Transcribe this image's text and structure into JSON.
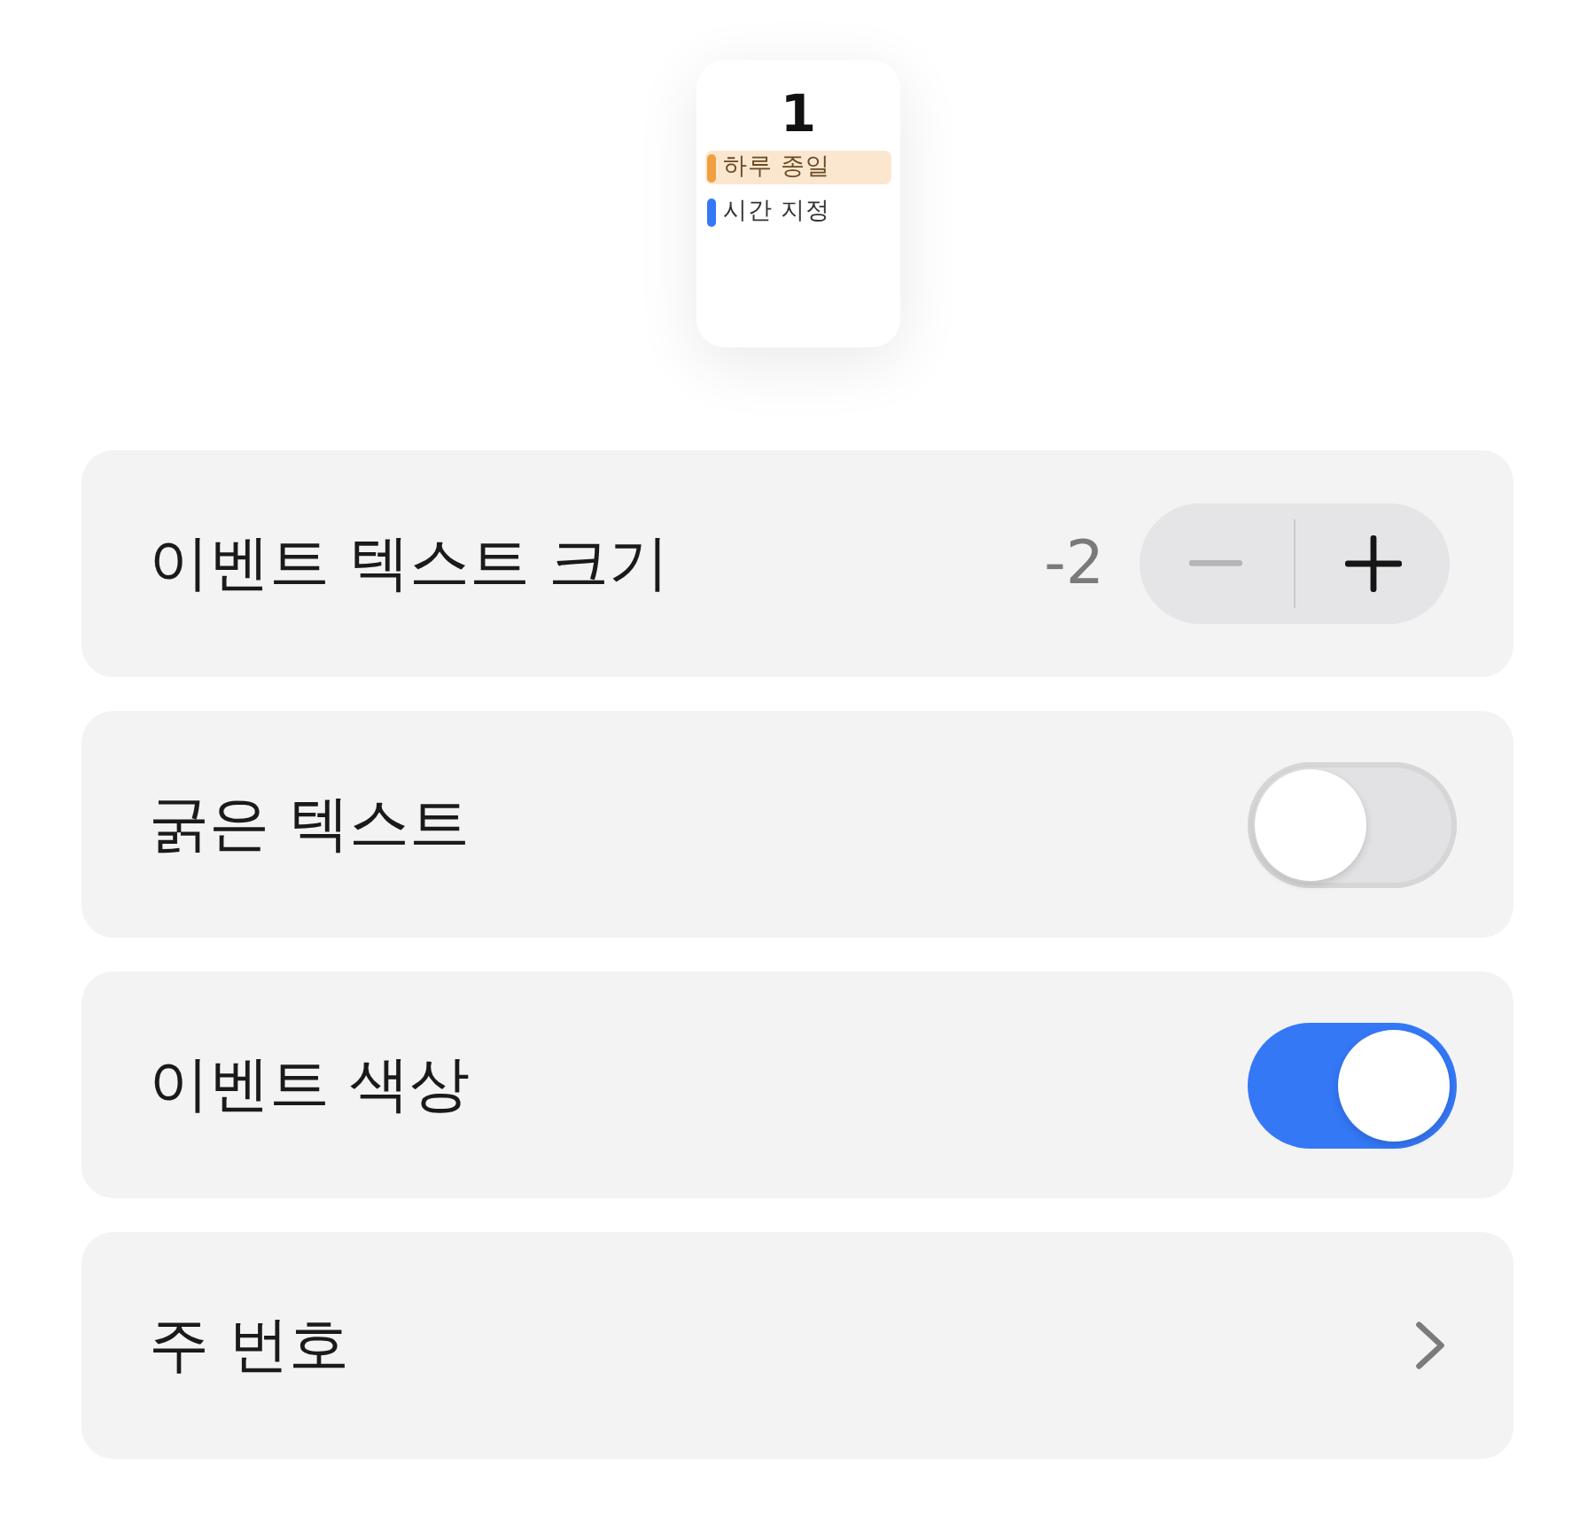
{
  "preview": {
    "day": "1",
    "events": [
      {
        "kind": "all_day",
        "title": "하루 종일",
        "color": "#f0a040"
      },
      {
        "kind": "timed",
        "title": "시간 지정",
        "color": "#3478f6"
      }
    ]
  },
  "settings": [
    {
      "kind": "stepper",
      "label": "이벤트 텍스트 크기",
      "value": "-2",
      "decrement_disabled": true,
      "increment_disabled": false
    },
    {
      "kind": "toggle",
      "label": "굵은 텍스트",
      "on": false
    },
    {
      "kind": "toggle",
      "label": "이벤트 색상",
      "on": true
    },
    {
      "kind": "link",
      "label": "주 번호"
    }
  ]
}
